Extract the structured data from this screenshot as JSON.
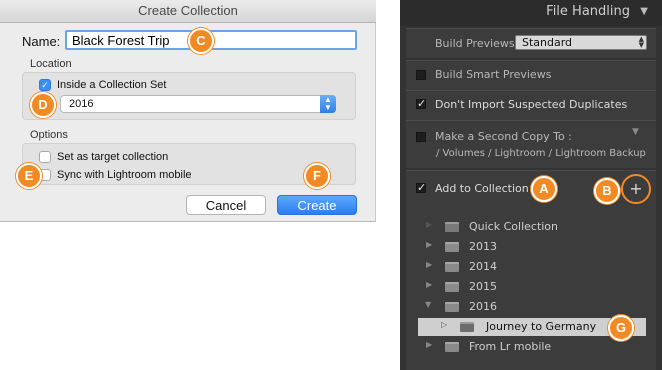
{
  "dialog": {
    "title": "Create Collection",
    "name_label": "Name:",
    "name_value": "Black Forest Trip",
    "location_label": "Location",
    "inside_set_label": "Inside a Collection Set",
    "set_value": "2016",
    "options_label": "Options",
    "target_label": "Set as target collection",
    "sync_label": "Sync with Lightroom mobile",
    "cancel_label": "Cancel",
    "create_label": "Create"
  },
  "callouts": {
    "a": "A",
    "b": "B",
    "c": "C",
    "d": "D",
    "e": "E",
    "f": "F",
    "g": "G"
  },
  "panel": {
    "title": "File Handling",
    "build_previews_label": "Build Previews",
    "build_previews_value": "Standard",
    "smart_previews_label": "Build Smart Previews",
    "duplicates_label": "Don't Import Suspected Duplicates",
    "second_copy_label": "Make a Second Copy To :",
    "second_copy_path": "/ Volumes / Lightroom / Lightroom Backup",
    "add_collection_label": "Add to Collection",
    "plus_label": "+",
    "collections": [
      {
        "label": "Quick Collection"
      },
      {
        "label": "2013"
      },
      {
        "label": "2014"
      },
      {
        "label": "2015"
      },
      {
        "label": "2016"
      },
      {
        "label": "Journey to Germany"
      },
      {
        "label": "From Lr mobile"
      }
    ]
  },
  "colors": {
    "callout": "#f08a24",
    "mac_blue": "#2a7ef2",
    "lr_panel": "#333333"
  },
  "icons": {
    "disclosure_collapsed": "triangle-right-icon",
    "disclosure_expanded": "triangle-down-icon",
    "collection_set": "collection-set-icon",
    "collection": "collection-icon"
  }
}
